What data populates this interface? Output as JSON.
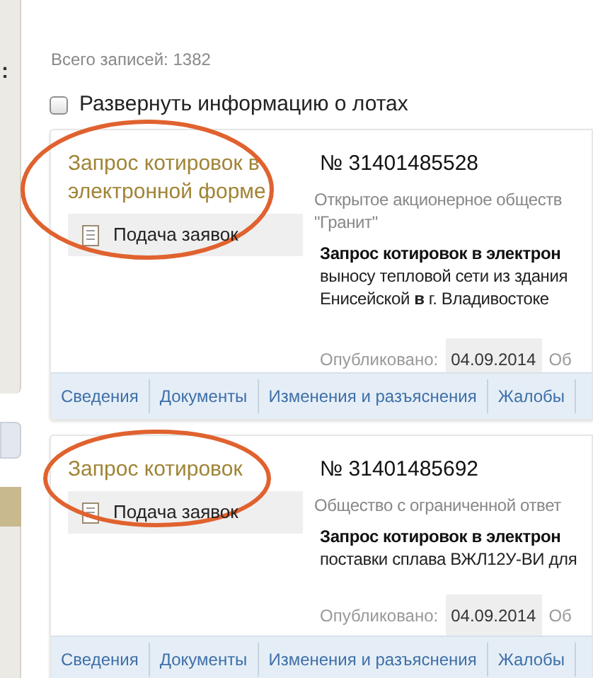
{
  "sidebar": {
    "label_fragment": ":"
  },
  "total": "Всего записей: 1382",
  "expand_lots": {
    "label": "Развернуть информацию о лотах",
    "checked": false
  },
  "cards": [
    {
      "type": "Запрос котировок в электронной форме",
      "stage": "Подача заявок",
      "number": "№ 31401485528",
      "customer": [
        "Открытое акционерное обществ",
        "\"Гранит\""
      ],
      "subject": "Запрос котировок в электрон",
      "description": [
        "выносу тепловой сети из здания",
        "Енисейской **в** г. Владивостоке"
      ],
      "published_label": "Опубликовано:",
      "published_date": "04.09.2014",
      "next_label": "Об",
      "tabs": [
        "Сведения",
        "Документы",
        "Изменения и разъяснения",
        "Жалобы"
      ]
    },
    {
      "type": "Запрос котировок",
      "stage": "Подача заявок",
      "number": "№ 31401485692",
      "customer": [
        "Общество с ограниченной ответ"
      ],
      "subject": "Запрос котировок в электрон",
      "description": [
        "поставки сплава ВЖЛ12У-ВИ для"
      ],
      "published_label": "Опубликовано:",
      "published_date": "04.09.2014",
      "next_label": "Об",
      "tabs": [
        "Сведения",
        "Документы",
        "Изменения и разъяснения",
        "Жалобы"
      ]
    }
  ]
}
